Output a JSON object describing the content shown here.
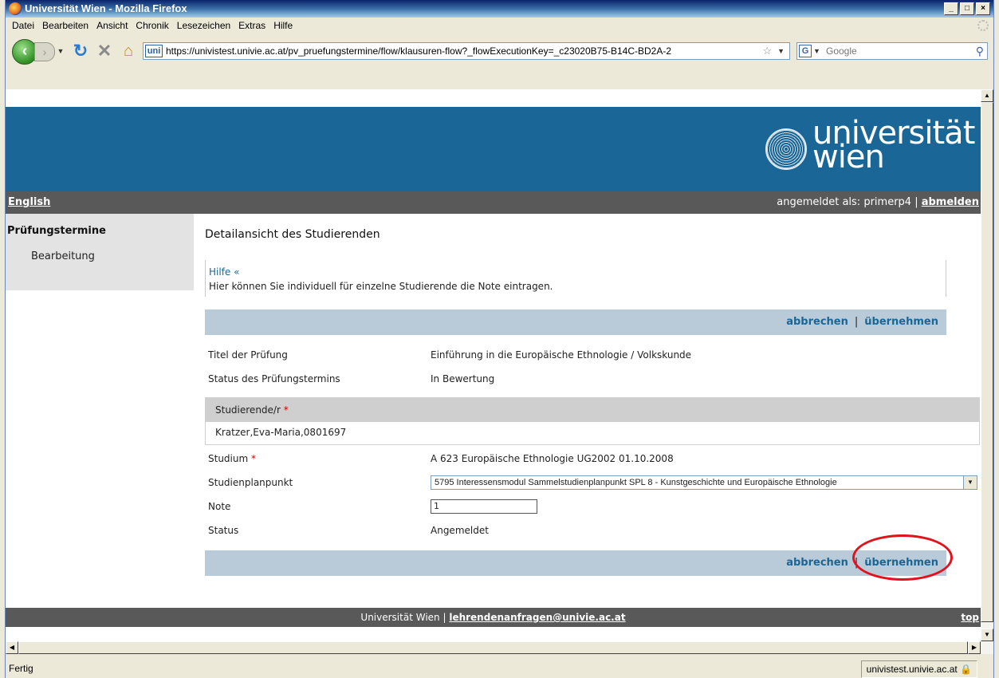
{
  "window": {
    "title": "Universität Wien - Mozilla Firefox",
    "buttons": [
      "_",
      "□",
      "×"
    ]
  },
  "menu": [
    "Datei",
    "Bearbeiten",
    "Ansicht",
    "Chronik",
    "Lesezeichen",
    "Extras",
    "Hilfe"
  ],
  "navbar": {
    "favicon_text": "uni",
    "url": "https://univistest.univie.ac.at/pv_pruefungstermine/flow/klausuren-flow?_flowExecutionKey=_c23020B75-B14C-BD2A-2",
    "search_placeholder": "Google",
    "search_engine_icon": "G"
  },
  "header": {
    "logo_line1": "universität",
    "logo_line2": "wien",
    "lang_link": "English",
    "login_prefix": "angemeldet als: primerp4 |",
    "logout": "abmelden"
  },
  "sidebar": {
    "heading": "Prüfungstermine",
    "items": [
      {
        "label": "Bearbeitung"
      }
    ]
  },
  "main": {
    "title": "Detailansicht des Studierenden",
    "help_link": "Hilfe «",
    "help_text": "Hier können Sie individuell für einzelne Studierende die Note eintragen.",
    "actions": {
      "cancel": "abbrechen",
      "sep": "|",
      "apply": "übernehmen"
    },
    "fields": {
      "exam_title_label": "Titel der Prüfung",
      "exam_title_value": "Einführung in die Europäische Ethnologie / Volkskunde",
      "exam_status_label": "Status des Prüfungstermins",
      "exam_status_value": "In Bewertung",
      "student_label": "Studierende/r",
      "student_value": "Kratzer,Eva-Maria,0801697",
      "studium_label": "Studium",
      "studium_value": "A 623 Europäische Ethnologie UG2002 01.10.2008",
      "plan_label": "Studienplanpunkt",
      "plan_value": "5795 Interessensmodul Sammelstudienplanpunkt SPL 8 - Kunstgeschichte und Europäische Ethnologie",
      "note_label": "Note",
      "note_value": "1",
      "status_label": "Status",
      "status_value": "Angemeldet",
      "required_mark": "*"
    }
  },
  "footer": {
    "text": "Universität Wien |",
    "email": "lehrendenanfragen@univie.ac.at",
    "top": "top"
  },
  "statusbar": {
    "status": "Fertig",
    "host": "univistest.univie.ac.at"
  },
  "colors": {
    "brand_blue": "#1a6696",
    "grey_bar": "#595959",
    "action_bar": "#b9cad9",
    "highlight": "#e4101b"
  }
}
